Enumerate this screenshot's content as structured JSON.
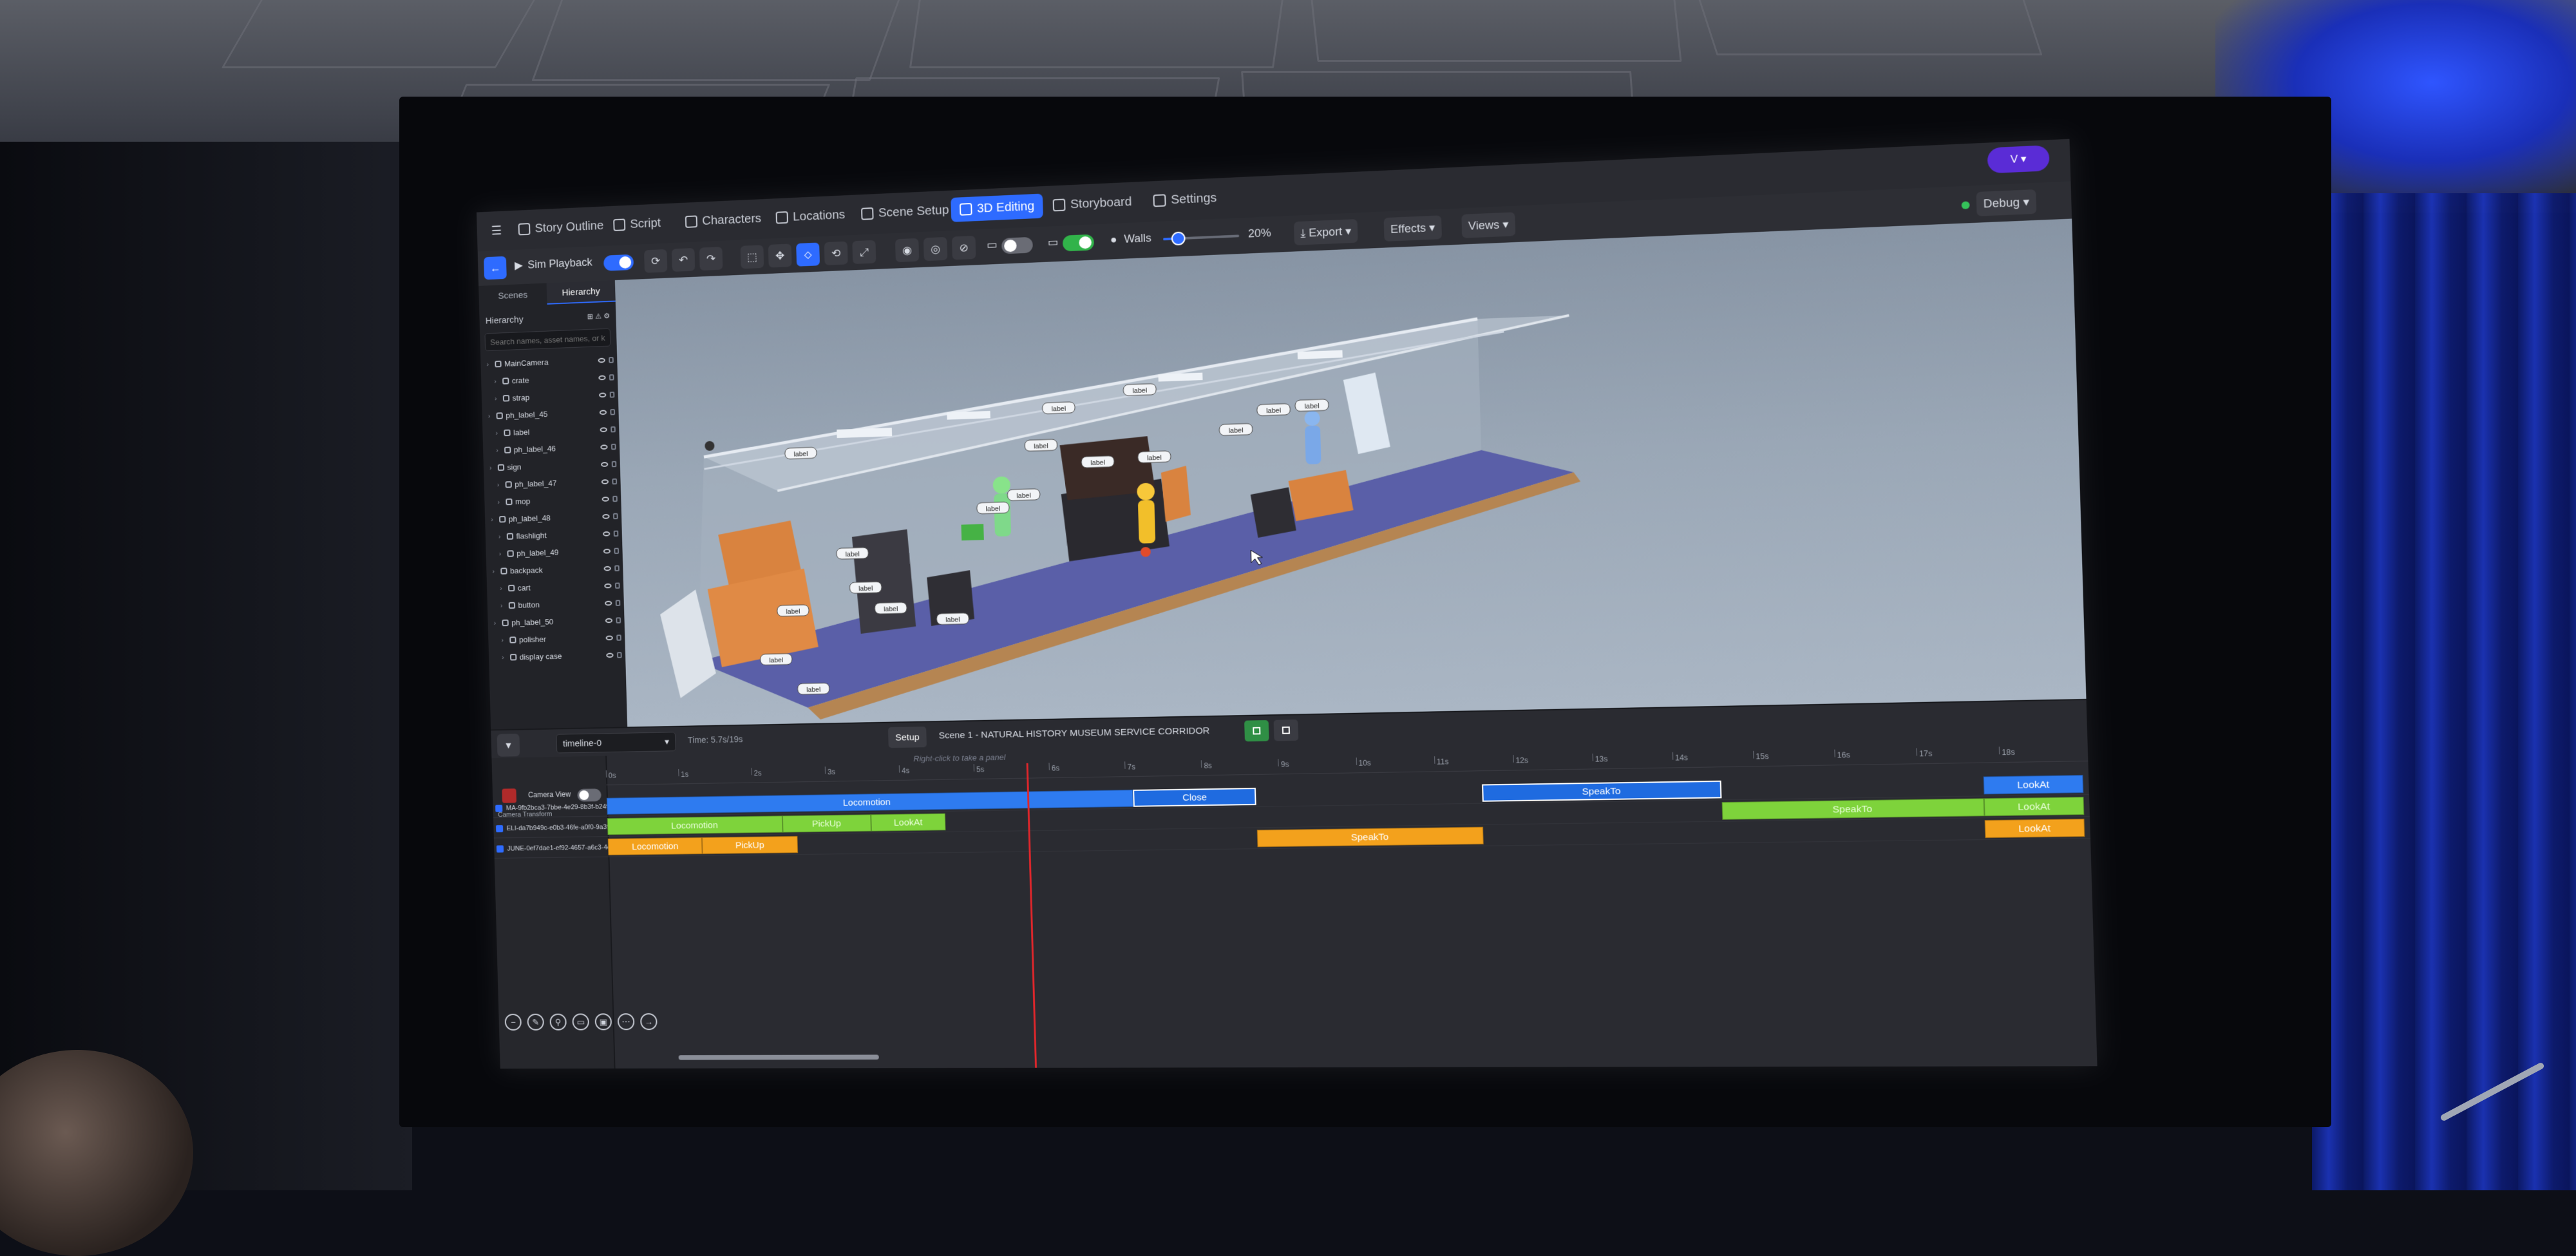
{
  "nav": {
    "tabs": [
      {
        "label": "Story Outline",
        "icon": "book-icon"
      },
      {
        "label": "Script",
        "icon": "document-icon"
      },
      {
        "label": "Characters",
        "icon": "people-icon"
      },
      {
        "label": "Locations",
        "icon": "building-icon"
      },
      {
        "label": "Scene Setup",
        "icon": "scene-icon"
      },
      {
        "label": "3D Editing",
        "icon": "cube-icon"
      },
      {
        "label": "Storyboard",
        "icon": "grid-icon"
      },
      {
        "label": "Settings",
        "icon": "gear-icon"
      }
    ],
    "active_tab": "3D Editing",
    "user_badge": "V ▾",
    "debug_label": "Debug",
    "accent_color": "#2e6bff"
  },
  "toolbar": {
    "sim_playback_label": "Sim Playback",
    "walls_label": "Walls",
    "walls_opacity": "20%",
    "walls_value": 0.2,
    "export_label": "Export",
    "effects_label": "Effects",
    "views_label": "Views"
  },
  "hierarchy": {
    "tabs": [
      "Scenes",
      "Hierarchy"
    ],
    "title": "Hierarchy",
    "search_placeholder": "Search names, asset names, or keywords...",
    "items": [
      {
        "name": "MainCamera"
      },
      {
        "name": "crate"
      },
      {
        "name": "strap"
      },
      {
        "name": "ph_label_45"
      },
      {
        "name": "label"
      },
      {
        "name": "ph_label_46"
      },
      {
        "name": "sign"
      },
      {
        "name": "ph_label_47"
      },
      {
        "name": "mop"
      },
      {
        "name": "ph_label_48"
      },
      {
        "name": "flashlight"
      },
      {
        "name": "ph_label_49"
      },
      {
        "name": "backpack"
      },
      {
        "name": "cart"
      },
      {
        "name": "button"
      },
      {
        "name": "ph_label_50"
      },
      {
        "name": "polisher"
      },
      {
        "name": "display case"
      }
    ]
  },
  "timeline": {
    "selector_label": "timeline-0",
    "time_readout": "Time: 5.7s/19s",
    "setup_label": "Setup",
    "scene_title": "Scene 1 - NATURAL HISTORY MUSEUM SERVICE CORRIDOR",
    "hint": "Right-click to take a panel",
    "camera_view_label": "Camera View",
    "camera_transform_label": "Camera Transform",
    "ruler_ticks": [
      "0s",
      "1s",
      "2s",
      "3s",
      "4s",
      "5s",
      "6s",
      "7s",
      "8s",
      "9s",
      "10s",
      "11s",
      "12s",
      "13s",
      "14s",
      "15s",
      "16s",
      "17s",
      "18s"
    ],
    "playhead_seconds": 5.7,
    "duration_seconds": 19,
    "tracks": [
      {
        "label": "MA-9fb2bca3-7bbe-4e29-8b3f-b249...",
        "color": "#2e7bf0",
        "clips": [
          {
            "label": "Locomotion",
            "start": 0,
            "end": 7.1,
            "style": "blue"
          },
          {
            "label": "Close",
            "start": 7.1,
            "end": 8.7,
            "style": "outline"
          },
          {
            "label": "SpeakTo",
            "start": 11.6,
            "end": 14.6,
            "style": "outline"
          },
          {
            "label": "LookAt",
            "start": 17.8,
            "end": 19,
            "style": "blue"
          }
        ]
      },
      {
        "label": "ELI-da7b949c-e0b3-46fe-a0f0-9a39...",
        "color": "#7ed33b",
        "clips": [
          {
            "label": "Locomotion",
            "start": 0,
            "end": 2.4,
            "style": "green"
          },
          {
            "label": "PickUp",
            "start": 2.4,
            "end": 3.6,
            "style": "green"
          },
          {
            "label": "LookAt",
            "start": 3.6,
            "end": 4.6,
            "style": "green"
          },
          {
            "label": "SpeakTo",
            "start": 14.6,
            "end": 17.8,
            "style": "green"
          },
          {
            "label": "LookAt",
            "start": 17.8,
            "end": 19,
            "style": "green"
          }
        ]
      },
      {
        "label": "JUNE-0ef7dae1-ef92-4657-a6c3-4e73...",
        "color": "#f3a11c",
        "clips": [
          {
            "label": "Locomotion",
            "start": 0,
            "end": 1.3,
            "style": "orange"
          },
          {
            "label": "PickUp",
            "start": 1.3,
            "end": 2.6,
            "style": "orange"
          },
          {
            "label": "SpeakTo",
            "start": 8.7,
            "end": 11.6,
            "style": "orange"
          },
          {
            "label": "LookAt",
            "start": 17.8,
            "end": 19,
            "style": "orange"
          }
        ]
      }
    ]
  },
  "viewport": {
    "scene_labels": [
      "label",
      "label",
      "label",
      "label",
      "label",
      "label",
      "label",
      "label",
      "label",
      "label",
      "label",
      "label",
      "label",
      "label",
      "label",
      "label",
      "label",
      "label"
    ]
  }
}
